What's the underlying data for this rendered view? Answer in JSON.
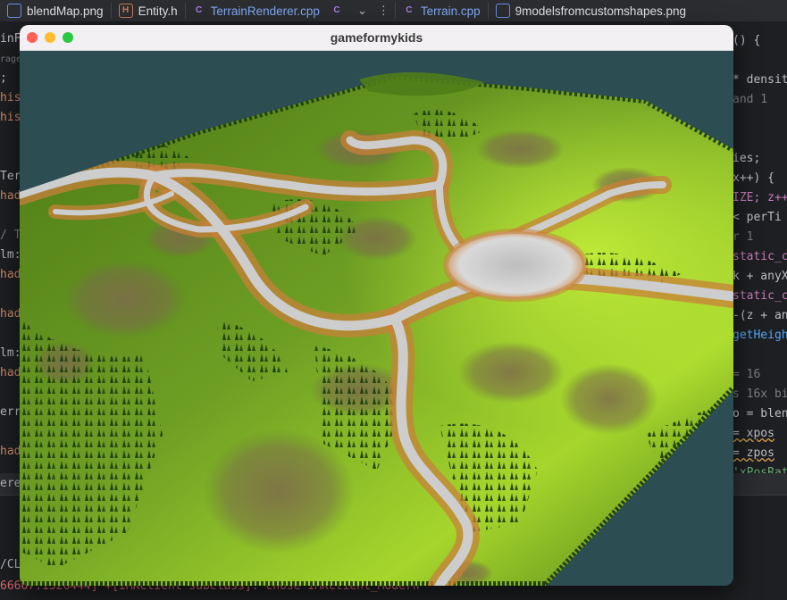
{
  "ide": {
    "tabs": [
      {
        "label": "blendMap.png",
        "icon": "image-file-icon",
        "active": false
      },
      {
        "label": "Entity.h",
        "icon": "header-file-icon",
        "active": false
      },
      {
        "label": "TerrainRenderer.cpp",
        "icon": "cpp-file-icon",
        "active": true
      },
      {
        "label": "Terrain.cpp",
        "icon": "cpp-file-icon",
        "active": true
      },
      {
        "label": "9modelsfromcustomshapes.png",
        "icon": "image-file-icon",
        "active": false
      }
    ],
    "overflow_icon": "chevron-down-icon",
    "menu_icon": "more-vert-icon",
    "left_gutter_lines": [
      "inF",
      "rage",
      ";",
      "his",
      "his",
      "",
      "",
      "Ter",
      "had",
      "",
      "/ T",
      "lm:",
      "had",
      "",
      "had",
      "",
      "lm:",
      "had",
      "",
      "err",
      "",
      "had"
    ],
    "right_code_lines": [
      "() {",
      "",
      "* densit",
      "and 1",
      "",
      "",
      "ies;",
      "x++) {",
      "IZE; z++",
      "< perTi",
      "r 1",
      "static_c",
      "k + anyX",
      "static_c",
      "-(z + an",
      "getHeigh",
      "",
      "= 16",
      "s 16x bi",
      "o = blen",
      "= xpos",
      "= zpos",
      "'xPosRat"
    ],
    "status_strip_text": "erer",
    "console": {
      "path_fragment": "/CL",
      "error_line": "66667.1326444] +[IMKClient subclass]: chose IMKClient_Modern"
    }
  },
  "game_window": {
    "title": "gameformykids",
    "controls": [
      "close",
      "minimize",
      "zoom"
    ],
    "sky_color": "#2c4d52",
    "terrain_color": "#5c8a1e",
    "path_color": "#c8c8c8",
    "dirt_color": "#b87a3a"
  }
}
